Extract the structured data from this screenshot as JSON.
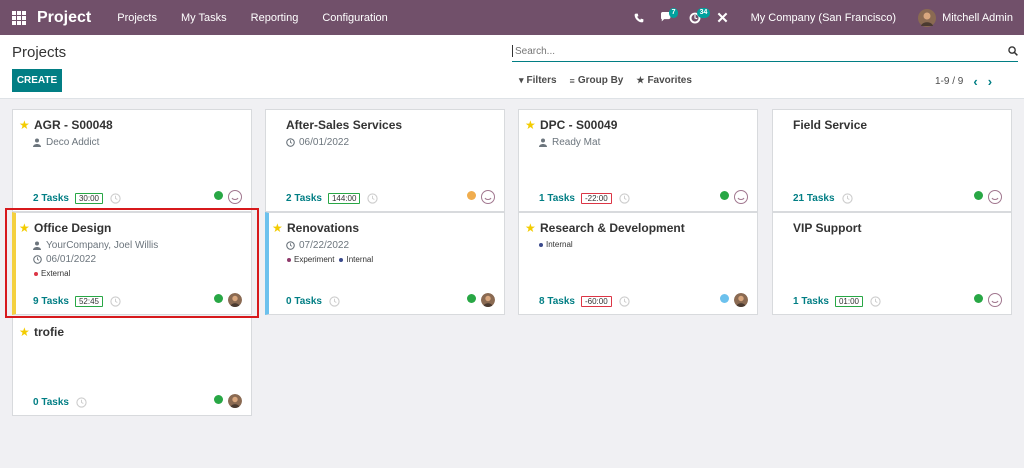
{
  "navbar": {
    "brand": "Project",
    "menu": [
      "Projects",
      "My Tasks",
      "Reporting",
      "Configuration"
    ],
    "phone_icon": "phone-icon",
    "chat_badge": "7",
    "activity_badge": "34",
    "company": "My Company (San Francisco)",
    "user_name": "Mitchell Admin"
  },
  "control_panel": {
    "title": "Projects",
    "create_label": "CREATE",
    "search_placeholder": "Search...",
    "filters_label": "Filters",
    "group_by_label": "Group By",
    "favorites_label": "Favorites",
    "pager": "1-9 / 9"
  },
  "colors": {
    "navbar": "#71506a",
    "primary": "#017e84",
    "star": "#f3cc00",
    "status_green": "#28a745",
    "status_orange": "#f0ad4e",
    "status_blue": "#6cc1ed",
    "highlight": "#d7191c"
  },
  "cards": [
    {
      "title": "AGR - S00048",
      "starred": true,
      "partner": "Deco Addict",
      "date": "",
      "tags": [],
      "tasks": "2 Tasks",
      "time": "30:00",
      "status": "green",
      "avatar": "empty"
    },
    {
      "title": "After-Sales Services",
      "starred": false,
      "partner": "",
      "date": "06/01/2022",
      "tags": [],
      "tasks": "2 Tasks",
      "time": "144:00",
      "status": "orange",
      "avatar": "empty"
    },
    {
      "title": "DPC - S00049",
      "starred": true,
      "partner": "Ready Mat",
      "date": "",
      "tags": [],
      "tasks": "1 Tasks",
      "time": "-22:00",
      "status": "green",
      "avatar": "empty"
    },
    {
      "title": "Field Service",
      "starred": false,
      "partner": "",
      "date": "",
      "tags": [],
      "tasks": "21 Tasks",
      "time": "",
      "status": "green",
      "avatar": "empty"
    },
    {
      "title": "Office Design",
      "starred": true,
      "partner": "YourCompany, Joel Willis",
      "date": "06/01/2022",
      "tags": [
        {
          "label": "External",
          "color": "#dc3545"
        }
      ],
      "tasks": "9 Tasks",
      "time": "52:45",
      "status": "green",
      "avatar": "photo"
    },
    {
      "title": "Renovations",
      "starred": true,
      "partner": "",
      "date": "07/22/2022",
      "tags": [
        {
          "label": "Experiment",
          "color": "#8f3a6b"
        },
        {
          "label": "Internal",
          "color": "#3b4a8c"
        }
      ],
      "tasks": "0 Tasks",
      "time": "",
      "status": "green",
      "avatar": "photo"
    },
    {
      "title": "Research & Development",
      "starred": true,
      "partner": "",
      "date": "",
      "tags": [
        {
          "label": "Internal",
          "color": "#3b4a8c"
        }
      ],
      "tasks": "8 Tasks",
      "time": "-60:00",
      "status": "blue",
      "avatar": "photo"
    },
    {
      "title": "VIP Support",
      "starred": false,
      "partner": "",
      "date": "",
      "tags": [],
      "tasks": "1 Tasks",
      "time": "01:00",
      "status": "green",
      "avatar": "empty"
    },
    {
      "title": "trofie",
      "starred": true,
      "partner": "",
      "date": "",
      "tags": [],
      "tasks": "0 Tasks",
      "time": "",
      "status": "green",
      "avatar": "photo"
    }
  ]
}
